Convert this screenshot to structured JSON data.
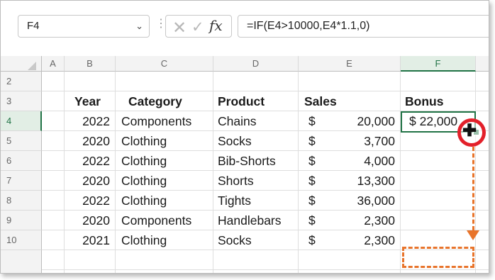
{
  "formula_bar": {
    "name_box": "F4",
    "cancel_icon": "close-icon",
    "enter_icon": "check-icon",
    "fx_label": "fx",
    "formula": "=IF(E4>10000,E4*1.1,0)"
  },
  "columns": [
    "A",
    "B",
    "C",
    "D",
    "E",
    "F"
  ],
  "rows": [
    "2",
    "3",
    "4",
    "5",
    "6",
    "7",
    "8",
    "9",
    "10"
  ],
  "headers": {
    "year": "Year",
    "category": "Category",
    "product": "Product",
    "sales": "Sales",
    "bonus": "Bonus"
  },
  "data_rows": [
    {
      "year": "2022",
      "category": "Components",
      "product": "Chains",
      "currency": "$",
      "sales": "20,000",
      "bonus": "$ 22,000"
    },
    {
      "year": "2020",
      "category": "Clothing",
      "product": "Socks",
      "currency": "$",
      "sales": "3,700",
      "bonus": ""
    },
    {
      "year": "2022",
      "category": "Clothing",
      "product": "Bib-Shorts",
      "currency": "$",
      "sales": "4,000",
      "bonus": ""
    },
    {
      "year": "2020",
      "category": "Clothing",
      "product": "Shorts",
      "currency": "$",
      "sales": "13,300",
      "bonus": ""
    },
    {
      "year": "2022",
      "category": "Clothing",
      "product": "Tights",
      "currency": "$",
      "sales": "36,000",
      "bonus": ""
    },
    {
      "year": "2020",
      "category": "Components",
      "product": "Handlebars",
      "currency": "$",
      "sales": "2,300",
      "bonus": ""
    },
    {
      "year": "2021",
      "category": "Clothing",
      "product": "Socks",
      "currency": "$",
      "sales": "2,300",
      "bonus": ""
    }
  ],
  "colors": {
    "selection": "#217346",
    "annotation_circle": "#e3202a",
    "annotation_arrow": "#e8742b"
  }
}
